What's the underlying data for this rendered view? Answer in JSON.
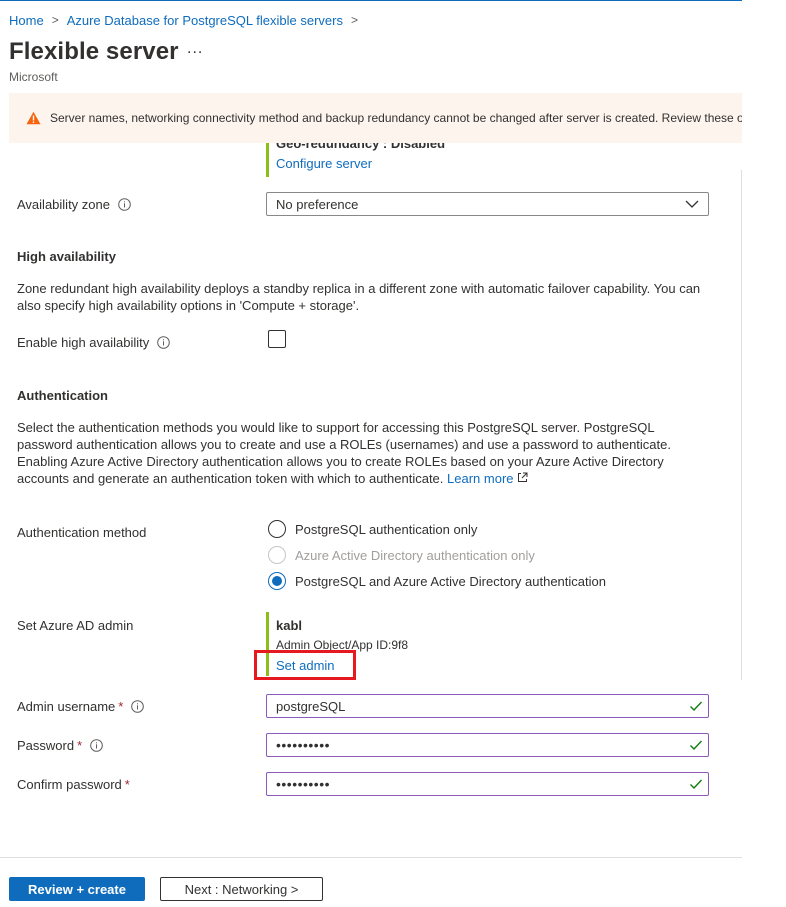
{
  "breadcrumb": {
    "items": [
      "Home",
      "Azure Database for PostgreSQL flexible servers"
    ],
    "separator": ">"
  },
  "header": {
    "title": "Flexible server",
    "more": "...",
    "publisher": "Microsoft"
  },
  "warning": {
    "text": "Server names, networking connectivity method and backup redundancy cannot be changed after server is created. Review these op"
  },
  "compute_summary": {
    "geo_redundancy": "Geo-redundancy : Disabled",
    "configure_link": "Configure server"
  },
  "availability_zone": {
    "label": "Availability zone",
    "value": "No preference"
  },
  "high_availability": {
    "heading": "High availability",
    "description": "Zone redundant high availability deploys a standby replica in a different zone with automatic failover capability. You can also specify high availability options in 'Compute + storage'.",
    "enable_label": "Enable high availability",
    "enabled": false
  },
  "authentication": {
    "heading": "Authentication",
    "description": "Select the authentication methods you would like to support for accessing this PostgreSQL server. PostgreSQL password authentication allows you to create and use a ROLEs (usernames) and use a password to authenticate. Enabling Azure Active Directory authentication allows you to create ROLEs based on your Azure Active Directory accounts and generate an authentication token with which to authenticate.",
    "learn_more": "Learn more",
    "method_label": "Authentication method",
    "options": [
      {
        "label": "PostgreSQL authentication only",
        "state": "unchecked"
      },
      {
        "label": "Azure Active Directory authentication only",
        "state": "disabled"
      },
      {
        "label": "PostgreSQL and Azure Active Directory authentication",
        "state": "checked"
      }
    ]
  },
  "ad_admin": {
    "label": "Set Azure AD admin",
    "name": "kabl",
    "object_id": "Admin Object/App ID:9f8",
    "set_admin_link": "Set admin"
  },
  "admin_username": {
    "label": "Admin username",
    "required": "*",
    "value": "postgreSQL"
  },
  "password": {
    "label": "Password",
    "required": "*",
    "value": "••••••••••"
  },
  "confirm_password": {
    "label": "Confirm password",
    "required": "*",
    "value": "••••••••••"
  },
  "footer": {
    "review_create": "Review + create",
    "next": "Next : Networking >"
  },
  "colors": {
    "accent": "#0f6cbd",
    "warning_bg": "#fdf4ee",
    "warning_icon": "#f7630c",
    "success": "#107c10",
    "highlight": "#e5191f",
    "summary_bar": "#8cbd18"
  },
  "icons": {
    "warning": "warning-icon",
    "info": "info-icon",
    "chevron": "chevron-down-icon",
    "check": "checkmark-icon",
    "external": "external-link-icon"
  }
}
